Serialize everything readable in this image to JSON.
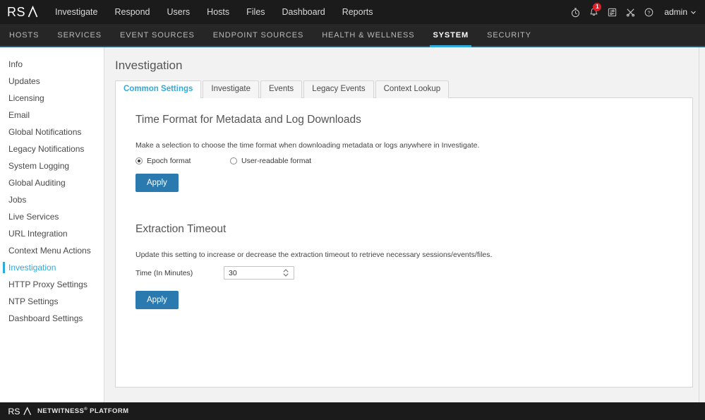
{
  "header": {
    "brand": "RSA",
    "nav": [
      {
        "label": "Investigate"
      },
      {
        "label": "Respond"
      },
      {
        "label": "Users"
      },
      {
        "label": "Hosts"
      },
      {
        "label": "Files"
      },
      {
        "label": "Dashboard"
      },
      {
        "label": "Reports"
      }
    ],
    "icons": [
      {
        "name": "stopwatch-icon"
      },
      {
        "name": "notification-bell-icon",
        "badge": "1"
      },
      {
        "name": "tasks-icon"
      },
      {
        "name": "configure-icon"
      },
      {
        "name": "help-icon"
      }
    ],
    "user": {
      "label": "admin",
      "chevron": "⌄"
    }
  },
  "subnav": {
    "items": [
      {
        "label": "HOSTS",
        "active": false
      },
      {
        "label": "SERVICES",
        "active": false
      },
      {
        "label": "EVENT SOURCES",
        "active": false
      },
      {
        "label": "ENDPOINT SOURCES",
        "active": false
      },
      {
        "label": "HEALTH & WELLNESS",
        "active": false
      },
      {
        "label": "SYSTEM",
        "active": true
      },
      {
        "label": "SECURITY",
        "active": false
      }
    ]
  },
  "sidebar": {
    "items": [
      {
        "label": "Info",
        "active": false
      },
      {
        "label": "Updates",
        "active": false
      },
      {
        "label": "Licensing",
        "active": false
      },
      {
        "label": "Email",
        "active": false
      },
      {
        "label": "Global Notifications",
        "active": false
      },
      {
        "label": "Legacy Notifications",
        "active": false
      },
      {
        "label": "System Logging",
        "active": false
      },
      {
        "label": "Global Auditing",
        "active": false
      },
      {
        "label": "Jobs",
        "active": false
      },
      {
        "label": "Live Services",
        "active": false
      },
      {
        "label": "URL Integration",
        "active": false
      },
      {
        "label": "Context Menu Actions",
        "active": false
      },
      {
        "label": "Investigation",
        "active": true
      },
      {
        "label": "HTTP Proxy Settings",
        "active": false
      },
      {
        "label": "NTP Settings",
        "active": false
      },
      {
        "label": "Dashboard Settings",
        "active": false
      }
    ]
  },
  "main": {
    "title": "Investigation",
    "tabs": [
      {
        "label": "Common Settings",
        "active": true
      },
      {
        "label": "Investigate",
        "active": false
      },
      {
        "label": "Events",
        "active": false
      },
      {
        "label": "Legacy Events",
        "active": false
      },
      {
        "label": "Context Lookup",
        "active": false
      }
    ],
    "section_time_format": {
      "title": "Time Format for Metadata and Log Downloads",
      "description": "Make a selection to choose the time format when downloading metadata or logs anywhere in Investigate.",
      "options": [
        {
          "label": "Epoch format",
          "selected": true
        },
        {
          "label": "User-readable format",
          "selected": false
        }
      ],
      "apply_label": "Apply"
    },
    "section_extraction_timeout": {
      "title": "Extraction Timeout",
      "description": "Update this setting to increase or decrease the extraction timeout to retrieve necessary sessions/events/files.",
      "field_label": "Time (In Minutes)",
      "field_value": "30",
      "apply_label": "Apply"
    }
  },
  "footer": {
    "brand": "RSA",
    "product": "NETWITNESS",
    "trademark": "®",
    "suffix": "PLATFORM"
  },
  "colors": {
    "accent": "#2eaadc",
    "button": "#2a7aaf",
    "header_bg": "#1b1b1b",
    "subnav_bg": "#262626",
    "badge": "#d9202a"
  }
}
